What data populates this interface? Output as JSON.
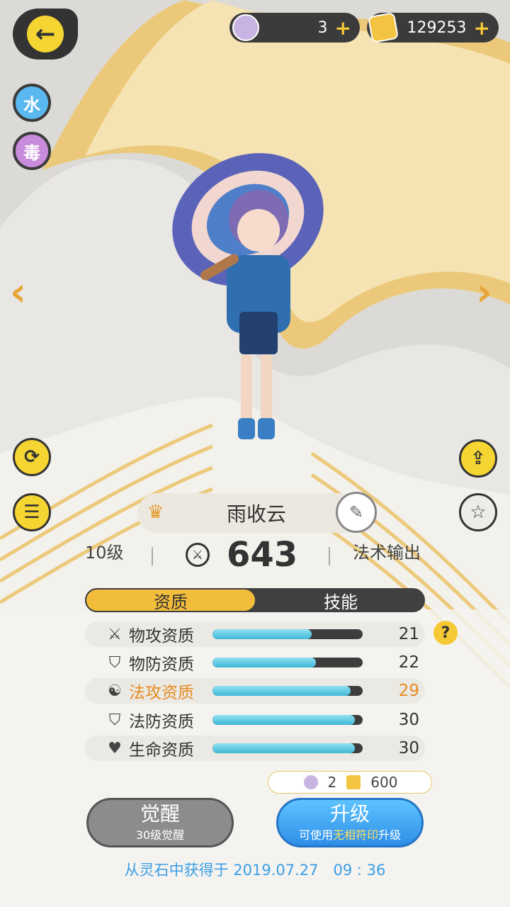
{
  "header": {
    "back_label": "←",
    "currency": [
      {
        "icon": "spirit-stone-icon",
        "amount": "3"
      },
      {
        "icon": "gold-crystal-icon",
        "amount": "129253"
      }
    ],
    "plus": "+"
  },
  "elements": [
    {
      "label": "水",
      "color": "#5ab8f0"
    },
    {
      "label": "毒",
      "color": "#c98bdc"
    }
  ],
  "nav": {
    "prev": "‹",
    "next": "›"
  },
  "character": {
    "name": "雨收云",
    "level": "10级",
    "power": "643",
    "role": "法术输出"
  },
  "tabs": [
    {
      "label": "资质",
      "active": true
    },
    {
      "label": "技能",
      "active": false
    }
  ],
  "attributes": [
    {
      "icon": "swords-icon",
      "label": "物攻资质",
      "value": "21",
      "fill": 0.66,
      "highlight": false
    },
    {
      "icon": "shield-icon",
      "label": "物防资质",
      "value": "22",
      "fill": 0.69,
      "highlight": false
    },
    {
      "icon": "magic-swirl-icon",
      "label": "法攻资质",
      "value": "29",
      "fill": 0.92,
      "highlight": true
    },
    {
      "icon": "magic-shield-icon",
      "label": "法防资质",
      "value": "30",
      "fill": 0.95,
      "highlight": false
    },
    {
      "icon": "heart-icon",
      "label": "生命资质",
      "value": "30",
      "fill": 0.95,
      "highlight": false
    }
  ],
  "help": "?",
  "cost": {
    "stones": "2",
    "gold": "600"
  },
  "buttons": {
    "awaken": {
      "label": "觉醒",
      "sub": "30级觉醒"
    },
    "upgrade": {
      "label": "升级",
      "sub_prefix": "可使用",
      "sub_highlight": "无相符印",
      "sub_suffix": "升级"
    }
  },
  "obtained": "从灵石中获得于 2019.07.27　09 : 36"
}
